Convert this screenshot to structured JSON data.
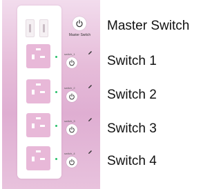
{
  "master": {
    "small_label": "Master Switch",
    "big_label": "Master Switch"
  },
  "switches": [
    {
      "small_label": "switch_1",
      "big_label": "Switch 1"
    },
    {
      "small_label": "switch_2",
      "big_label": "Switch 2"
    },
    {
      "small_label": "switch_3",
      "big_label": "Switch 3"
    },
    {
      "small_label": "switch_4",
      "big_label": "Switch 4"
    }
  ],
  "colors": {
    "panel_gradient": "#dfaed2",
    "socket": "#e8b8d8",
    "led": "#27c06a"
  },
  "icons": {
    "power": "power-icon",
    "edit": "pencil-icon",
    "usb": "usb-port-icon",
    "socket": "uk-socket-icon"
  }
}
